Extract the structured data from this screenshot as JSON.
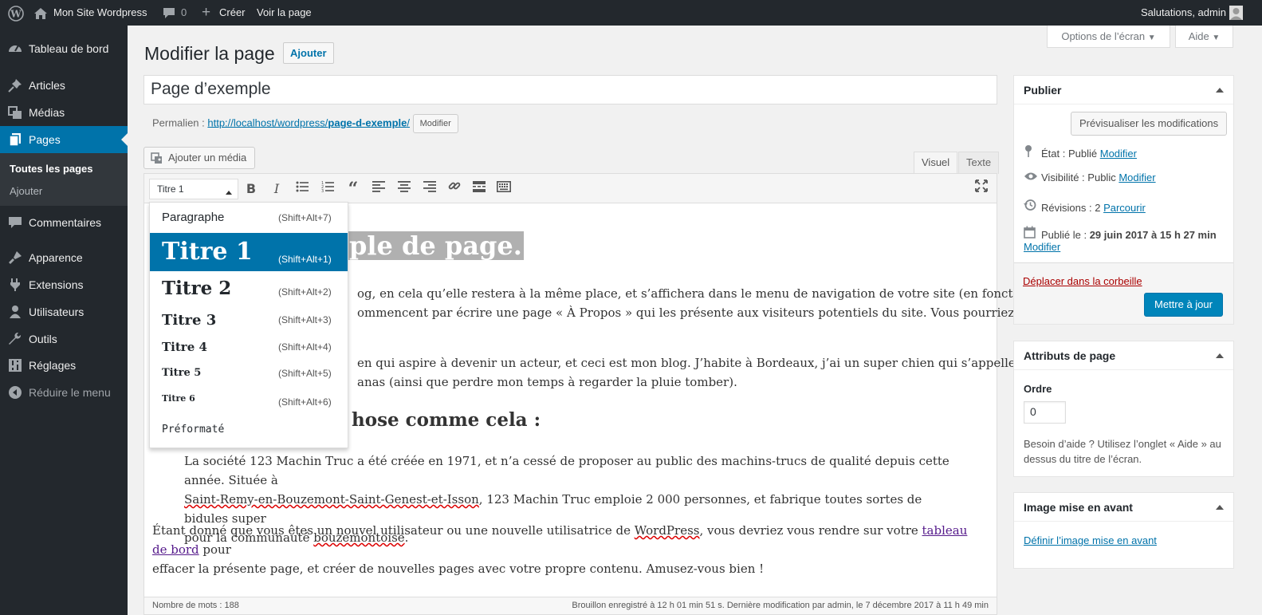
{
  "adminbar": {
    "wp_logo": "wordpress-icon",
    "site_name": "Mon Site Wordpress",
    "comments_count": "0",
    "new_label": "Créer",
    "view_label": "Voir la page",
    "greeting": "Salutations, admin"
  },
  "sidebar": {
    "items": [
      {
        "label": "Tableau de bord",
        "icon": "dashboard-icon"
      },
      {
        "label": "Articles",
        "icon": "pin-icon"
      },
      {
        "label": "Médias",
        "icon": "media-icon"
      },
      {
        "label": "Pages",
        "icon": "pages-icon"
      },
      {
        "label": "Commentaires",
        "icon": "comments-icon"
      },
      {
        "label": "Apparence",
        "icon": "appearance-icon"
      },
      {
        "label": "Extensions",
        "icon": "plugins-icon"
      },
      {
        "label": "Utilisateurs",
        "icon": "users-icon"
      },
      {
        "label": "Outils",
        "icon": "tools-icon"
      },
      {
        "label": "Réglages",
        "icon": "settings-icon"
      },
      {
        "label": "Réduire le menu",
        "icon": "collapse-icon"
      }
    ],
    "submenu": [
      "Toutes les pages",
      "Ajouter"
    ]
  },
  "header": {
    "screen_options": "Options de l’écran",
    "help": "Aide",
    "title": "Modifier la page",
    "add_new": "Ajouter"
  },
  "post": {
    "title": "Page d’exemple",
    "permalink_label": "Permalien :",
    "permalink_base": "http://localhost/wordpress/",
    "permalink_slug": "page-d-exemple",
    "permalink_trailing": "/",
    "permalink_edit": "Modifier"
  },
  "editor": {
    "add_media": "Ajouter un média",
    "tab_visual": "Visuel",
    "tab_text": "Texte",
    "format_selected": "Titre 1",
    "heading1_visible": "ple de page.",
    "p1_line1": "og, en cela qu’elle restera à la même place, et s’affichera dans le menu de navigation de votre site (en fonction de",
    "p1_line2": "ommencent par écrire une page « À Propos » qui les présente aux visiteurs potentiels du site. Vous pourriez y",
    "p2_line1": "en qui aspire à devenir un acteur, et ceci est mon blog. J’habite à Bordeaux, j’ai un super chien qui s’appelle",
    "p2_line2": "anas (ainsi que perdre mon temps à regarder la pluie tomber).",
    "heading2_visible": "hose comme cela :",
    "bq_line1": "La société 123 Machin Truc a été créée en 1971, et n’a cessé de proposer au public des machins-trucs de qualité depuis cette année. Située à",
    "bq_line2_sq": "Saint-Remy-en-Bouzemont-Saint-Genest-et-Isson",
    "bq_line2_rest": ", 123 Machin Truc emploie 2 000 personnes, et fabrique toutes sortes de bidules super",
    "bq_line3_a": "pour la communauté ",
    "bq_line3_sq": "bouzemontoise",
    "bq_line3_b": ".",
    "p3_line1_a": "Étant donné que vous êtes un nouvel utilisateur ou une nouvelle utilisatrice de ",
    "p3_line1_sq": "WordPress",
    "p3_line1_b": ", vous devriez vous rendre sur votre ",
    "p3_link": "tableau de bord",
    "p3_line1_c": " pour",
    "p3_line2": "effacer la présente page, et créer de nouvelles pages avec votre propre contenu. Amusez-vous bien !",
    "word_count": "Nombre de mots : 188",
    "save_status": "Brouillon enregistré à 12 h 01 min 51 s. Dernière modification par admin, le 7 décembre 2017 à 11 h 49 min"
  },
  "format_menu": [
    {
      "label": "Paragraphe",
      "shortcut": "(Shift+Alt+7)"
    },
    {
      "label": "Titre 1",
      "shortcut": "(Shift+Alt+1)"
    },
    {
      "label": "Titre 2",
      "shortcut": "(Shift+Alt+2)"
    },
    {
      "label": "Titre 3",
      "shortcut": "(Shift+Alt+3)"
    },
    {
      "label": "Titre 4",
      "shortcut": "(Shift+Alt+4)"
    },
    {
      "label": "Titre 5",
      "shortcut": "(Shift+Alt+5)"
    },
    {
      "label": "Titre 6",
      "shortcut": "(Shift+Alt+6)"
    },
    {
      "label": "Préformaté",
      "shortcut": ""
    }
  ],
  "publish": {
    "title": "Publier",
    "preview": "Prévisualiser les modifications",
    "status_label": "État : ",
    "status_value": "Publié",
    "visibility_label": "Visibilité : ",
    "visibility_value": "Public",
    "revisions_label": "Révisions : ",
    "revisions_value": "2",
    "browse": "Parcourir",
    "published_label": "Publié le : ",
    "published_value": "29 juin 2017 à 15 h 27 min",
    "edit": "Modifier",
    "trash": "Déplacer dans la corbeille",
    "update": "Mettre à jour"
  },
  "attributes": {
    "title": "Attributs de page",
    "order_label": "Ordre",
    "order_value": "0",
    "help_line1": "Besoin d’aide ? Utilisez l’onglet « Aide » au",
    "help_line2": "dessus du titre de l’écran."
  },
  "featured": {
    "title": "Image mise en avant",
    "set": "Définir l’image mise en avant"
  },
  "colors": {
    "accent": "#0073aa",
    "adminbar": "#23282d",
    "primary_button": "#0085ba",
    "trash": "#a00"
  }
}
